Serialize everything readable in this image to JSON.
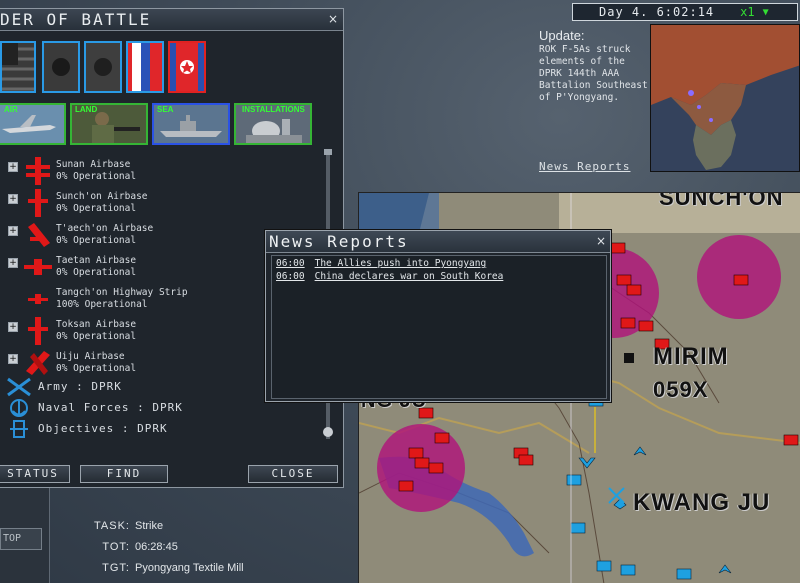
{
  "clock": {
    "day_time": "Day  4. 6:02:14",
    "speed": "x1",
    "speed_arrow": "▼"
  },
  "update": {
    "title": "Update:",
    "text": "ROK F-5As struck elements of the DPRK 144th AAA Battalion Southeast of P'Yongyang.",
    "news_link": "News Reports"
  },
  "oob": {
    "title": "DER OF BATTLE",
    "close": "×",
    "categories": [
      {
        "label": "AIR"
      },
      {
        "label": "LAND"
      },
      {
        "label": "SEA"
      },
      {
        "label": "INSTALLATIONS"
      }
    ],
    "airbases": [
      {
        "name": "Sunan Airbase",
        "status": "0% Operational",
        "expand": "+"
      },
      {
        "name": "Sunch'on Airbase",
        "status": "0% Operational",
        "expand": "+"
      },
      {
        "name": "T'aech'on Airbase",
        "status": "0% Operational",
        "expand": "+"
      },
      {
        "name": "Taetan Airbase",
        "status": "0% Operational",
        "expand": "+"
      },
      {
        "name": "Tangch'on Highway Strip",
        "status": "100% Operational",
        "expand": ""
      },
      {
        "name": "Toksan Airbase",
        "status": "0% Operational",
        "expand": "+"
      },
      {
        "name": "Uiju Airbase",
        "status": "0% Operational",
        "expand": "+"
      }
    ],
    "groups": [
      {
        "label": "Army : DPRK"
      },
      {
        "label": "Naval Forces : DPRK"
      },
      {
        "label": "Objectives : DPRK"
      }
    ],
    "buttons": {
      "status": "STATUS",
      "find": "FIND",
      "close": "CLOSE"
    }
  },
  "sidebar": {
    "top_button": "TOP"
  },
  "task": {
    "task_label": "TASK:",
    "task_value": "Strike",
    "tot_label": "TOT:",
    "tot_value": "06:28:45",
    "tgt_label": "TGT:",
    "tgt_value": "Pyongyang Textile Mill"
  },
  "news": {
    "title": "News Reports",
    "close": "×",
    "items": [
      {
        "time": "06:00",
        "text": "The Allies push into Pyongyang"
      },
      {
        "time": "06:00",
        "text": "China declares war on South Korea"
      }
    ]
  },
  "map": {
    "labels": {
      "mirim": "MIRIM",
      "code": "059X",
      "kwangju": "KWANG JU",
      "top_frag": "SUNCH'ON",
      "left_frag": "NG JU"
    }
  },
  "colors": {
    "enemy": "#e01818",
    "threat_circle": "#b0127a",
    "friendly": "#1ea0e0",
    "highlight": "#33dd33"
  }
}
